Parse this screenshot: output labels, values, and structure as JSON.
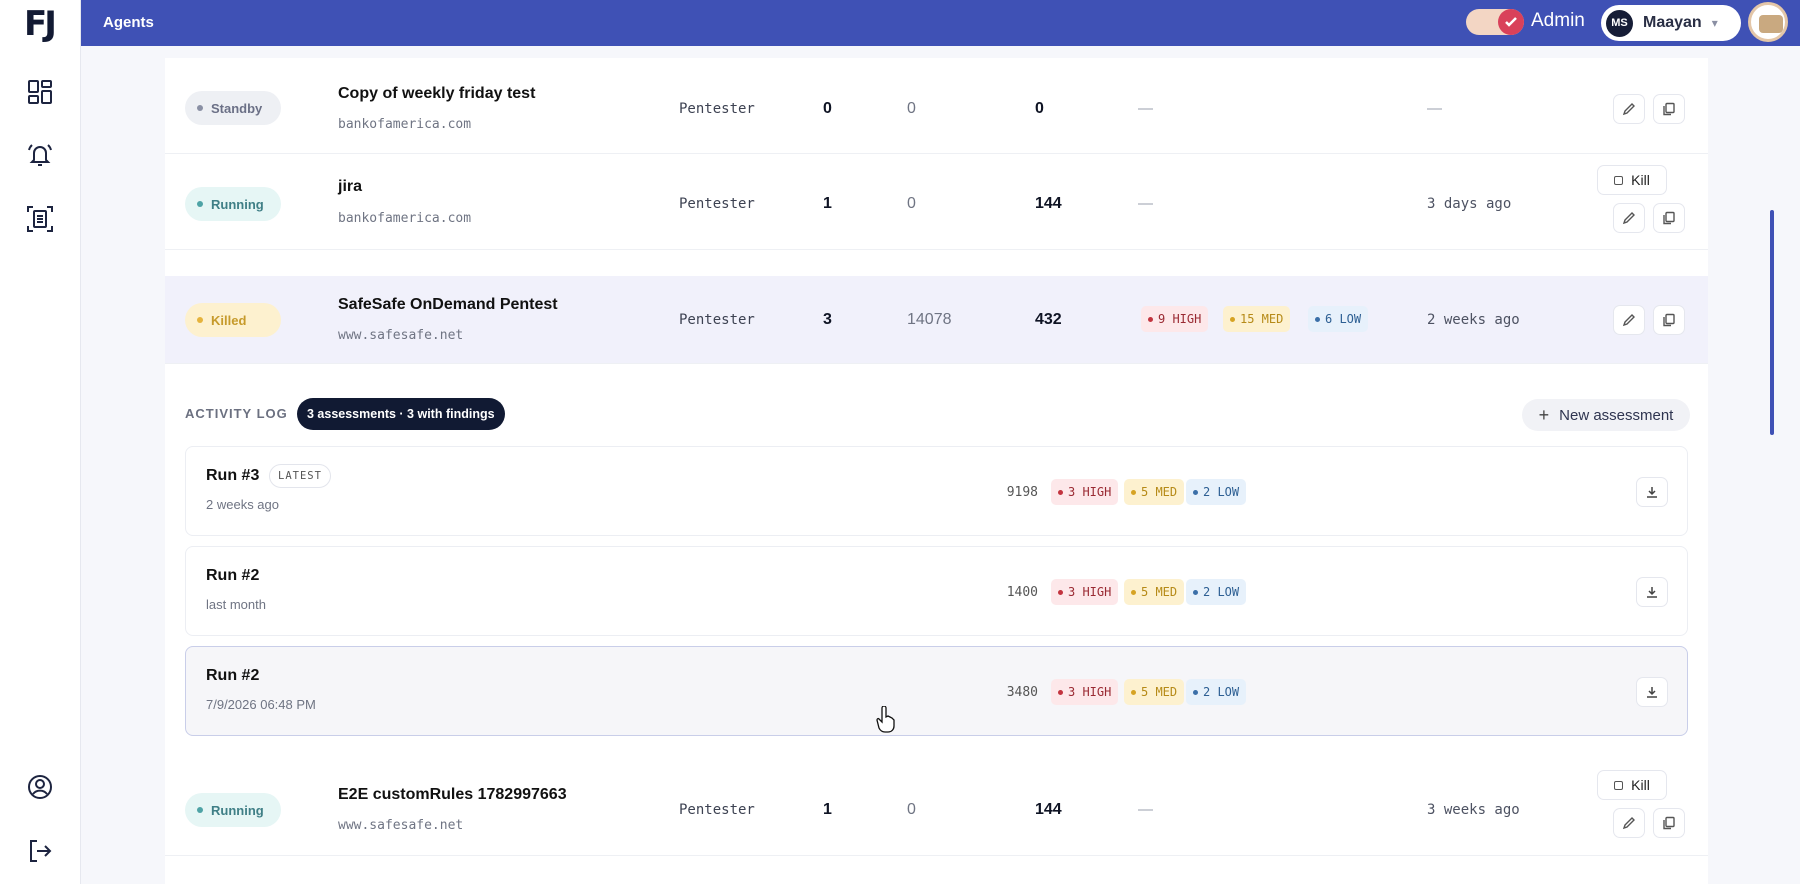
{
  "app": {
    "logo": "FJ",
    "page_title": "Agents"
  },
  "topbar": {
    "admin_label": "Admin",
    "user_initials": "MS",
    "user_name": "Maayan"
  },
  "sidebar": {
    "top_icons": [
      "dashboard-icon",
      "bell-alert-icon",
      "report-icon"
    ],
    "bottom_icons": [
      "account-icon",
      "logout-icon"
    ]
  },
  "agents": [
    {
      "status": "Standby",
      "name": "Copy of weekly friday test",
      "domain": "bankofamerica.com",
      "type": "Pentester",
      "n1": "0",
      "n2": "0",
      "n3": "0",
      "findings": "—",
      "last": "—"
    },
    {
      "status": "Running",
      "name": "jira",
      "domain": "bankofamerica.com",
      "type": "Pentester",
      "n1": "1",
      "n2": "0",
      "n3": "144",
      "findings": "—",
      "last": "3 days ago",
      "kill": "Kill"
    },
    {
      "status": "Killed",
      "name": "SafeSafe OnDemand Pentest",
      "domain": "www.safesafe.net",
      "type": "Pentester",
      "n1": "3",
      "n2": "14078",
      "n3": "432",
      "high": "9 HIGH",
      "med": "15 MED",
      "low": "6 LOW",
      "last": "2 weeks ago"
    },
    {
      "status": "Running",
      "name": "E2E customRules 1782997663",
      "domain": "www.safesafe.net",
      "type": "Pentester",
      "n1": "1",
      "n2": "0",
      "n3": "144",
      "findings": "—",
      "last": "3 weeks ago",
      "kill": "Kill"
    }
  ],
  "activity_log": {
    "label": "ACTIVITY LOG",
    "summary": "3 assessments · 3 with findings",
    "new_button": "New assessment",
    "runs": [
      {
        "title": "Run #3",
        "badge": "LATEST",
        "time": "2 weeks ago",
        "count": "9198",
        "high": "3 HIGH",
        "med": "5 MED",
        "low": "2 LOW"
      },
      {
        "title": "Run #2",
        "time": "last month",
        "count": "1400",
        "high": "3 HIGH",
        "med": "5 MED",
        "low": "2 LOW"
      },
      {
        "title": "Run #2",
        "time": "7/9/2026 06:48 PM",
        "count": "3480",
        "high": "3 HIGH",
        "med": "5 MED",
        "low": "2 LOW"
      }
    ]
  },
  "colors": {
    "brand": "#3f51b5",
    "high": "#c2343f",
    "med": "#d6a323",
    "low": "#3b6fa8",
    "navy": "#111a33"
  }
}
